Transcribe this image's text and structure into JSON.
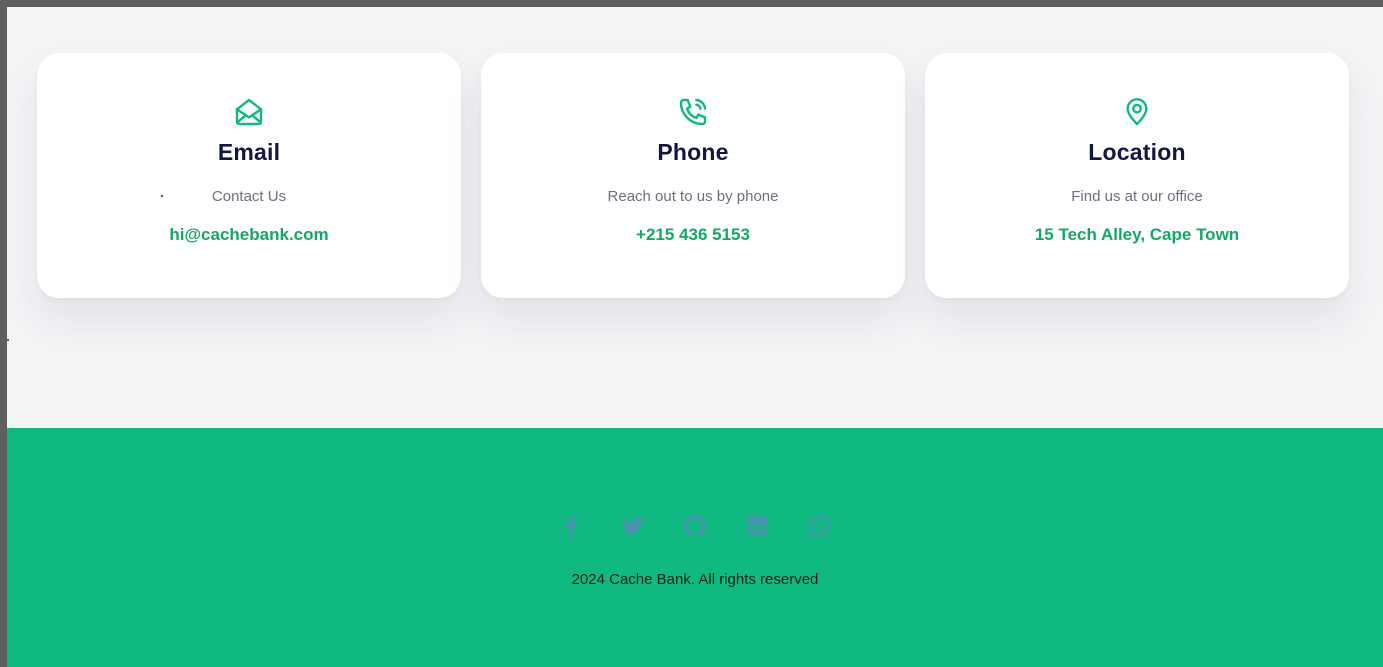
{
  "contact_cards": [
    {
      "icon": "envelope-open-icon",
      "title": "Email",
      "subtitle": "Contact Us",
      "value": "hi@cachebank.com"
    },
    {
      "icon": "phone-call-icon",
      "title": "Phone",
      "subtitle": "Reach out to us by phone",
      "value": "+215 436 5153"
    },
    {
      "icon": "map-pin-icon",
      "title": "Location",
      "subtitle": "Find us at our office",
      "value": "15 Tech Alley, Cape Town"
    }
  ],
  "footer": {
    "social_icons": [
      "facebook-icon",
      "twitter-icon",
      "github-icon",
      "linkedin-icon",
      "whatsapp-icon"
    ],
    "copyright": "2024 Cache Bank. All rights reserved"
  },
  "colors": {
    "accent": "#10b981",
    "accent_text": "#14a866",
    "heading": "#111642",
    "muted_text": "#6b7080",
    "social_icon": "#7c6fd6",
    "page_bg": "#f3f4f6"
  }
}
